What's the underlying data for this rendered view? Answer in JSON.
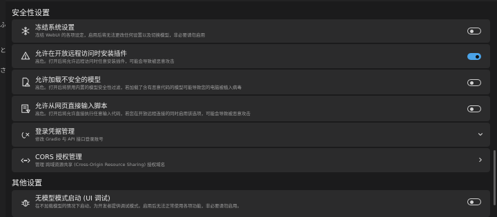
{
  "left_glyphs": [
    "ふ",
    "と",
    "さ"
  ],
  "sections": {
    "security_title": "安全性设置",
    "other_title": "其他设置"
  },
  "cards": {
    "freeze": {
      "icon": "snowflake-icon",
      "title": "冻结系统设置",
      "desc": "冻结 WebUI 的各项设定，启用后将无法更改任何设置以及切换模型，非必要请勿启用",
      "toggle_on": false
    },
    "remote_ext": {
      "icon": "warning-icon",
      "title": "允许在开放远程访问时安装插件",
      "desc": "高危。打开后将允许远程访问时任意安装插件，可能会导致被恶意攻击",
      "toggle_on": true
    },
    "unsafe_model": {
      "icon": "unsafe-file-icon",
      "title": "允许加载不安全的模型",
      "desc": "高危。打开后将禁用内置的模型安全性过滤，若加载了含有恶意代码的模型可能导致您的电脑被植入病毒",
      "toggle_on": false
    },
    "script": {
      "icon": "script-icon",
      "title": "允许从网页直接输入脚本",
      "desc": "高危。打开后将允许直接执行任意输入代码，若您在开放远程连接的同时启用该选项，可能会导致被恶意攻击",
      "toggle_on": false
    },
    "login": {
      "icon": "login-credential-icon",
      "title": "登录凭据管理",
      "desc": "修改 Gradio 与 API 接口登录账号"
    },
    "cors": {
      "icon": "cors-icon",
      "title": "CORS 授权管理",
      "desc": "管理 跨域资源共享 (Cross-Origin Resource Sharing) 授权域名"
    },
    "no_model": {
      "icon": "bug-icon",
      "title": "无模型模式启动 (UI 调试)",
      "desc": "在不加载模型的情况下启动，为开发者提供调试模式。启用后无法正常使用各项功能，非必要请勿启用。",
      "toggle_on": false
    }
  },
  "colors": {
    "background": "#1b1b1c",
    "card": "#2b2b2c",
    "accent": "#4aa3e8"
  }
}
